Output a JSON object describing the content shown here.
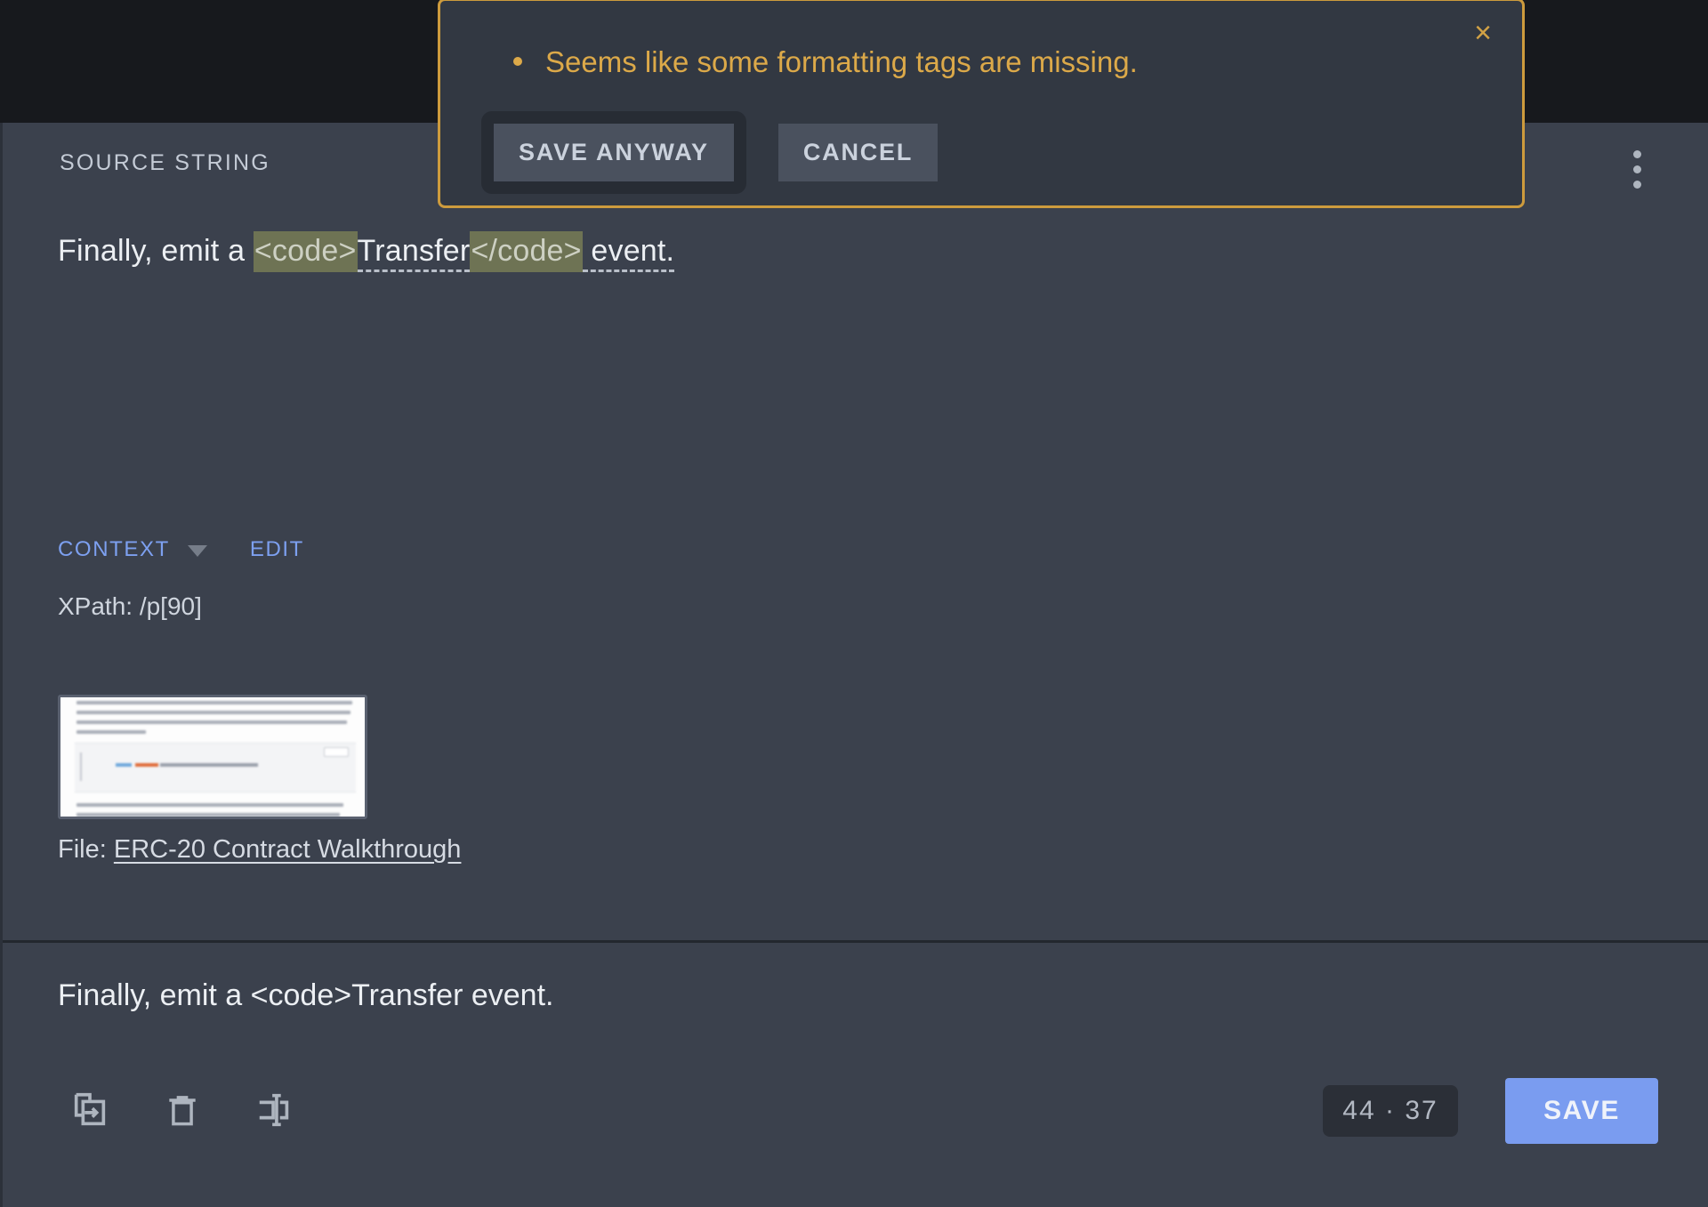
{
  "panel": {
    "source_label": "SOURCE STRING",
    "kebab_icon": "more-vert-icon"
  },
  "source": {
    "prefix": "Finally, emit a ",
    "open_tag": "<code>",
    "inner": "Transfer",
    "close_tag": "</code>",
    "suffix": " event."
  },
  "context": {
    "context_label": "CONTEXT",
    "edit_label": "EDIT",
    "caret_icon": "chevron-down-icon",
    "xpath": "XPath: /p[90]",
    "file_prefix": "File:",
    "file_name": "ERC-20 Contract Walkthrough"
  },
  "target": {
    "value": "Finally, emit a <code>Transfer event."
  },
  "toolbar": {
    "icons": [
      {
        "name": "copy-source-to-target-icon"
      },
      {
        "name": "delete-icon"
      },
      {
        "name": "split-segment-icon"
      }
    ],
    "count_badge": "44 · 37",
    "save_label": "SAVE"
  },
  "alert": {
    "message": "Seems like some formatting tags are missing.",
    "save_anyway_label": "SAVE ANYWAY",
    "cancel_label": "CANCEL",
    "close_icon": "×",
    "accent_color": "#cd9b3d",
    "text_color": "#dca949"
  }
}
